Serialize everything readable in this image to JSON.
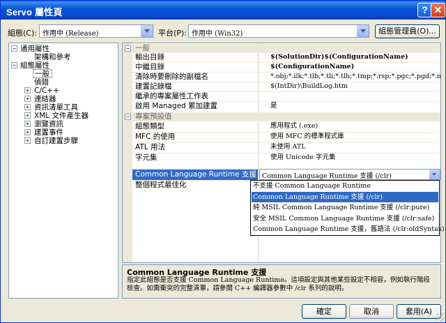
{
  "window": {
    "title": "Servo 屬性頁",
    "help_label": "?",
    "close_label": "✕"
  },
  "config_bar": {
    "config_label": "組態(C):",
    "config_value": "作用中 (Release)",
    "platform_label": "平台(P):",
    "platform_value": "作用中 (Win32)",
    "manager_button": "組態管理員(O)..."
  },
  "tree": {
    "items": [
      {
        "label": "通用屬性",
        "expand": "−"
      },
      {
        "label": "架構和參考",
        "expand": ""
      },
      {
        "label": "組態屬性",
        "expand": "−"
      },
      {
        "label": "一般",
        "expand": ""
      },
      {
        "label": "偵錯",
        "expand": ""
      },
      {
        "label": "C/C++",
        "expand": "+"
      },
      {
        "label": "連結器",
        "expand": "+"
      },
      {
        "label": "資訊清單工具",
        "expand": "+"
      },
      {
        "label": "XML 文件產生器",
        "expand": "+"
      },
      {
        "label": "瀏覽資訊",
        "expand": "+"
      },
      {
        "label": "建置事件",
        "expand": "+"
      },
      {
        "label": "自訂建置步驟",
        "expand": "+"
      }
    ]
  },
  "grid": {
    "categories": [
      {
        "label": "一般",
        "toggle": "−"
      },
      {
        "label": "專案預設值",
        "toggle": "−"
      }
    ],
    "general_rows": [
      {
        "name": "輸出目錄",
        "value": "$(SolutionDir)$(ConfigurationName)"
      },
      {
        "name": "中繼目錄",
        "value": "$(ConfigurationName)"
      },
      {
        "name": "清除時要刪除的副檔名",
        "value": "*.obj;*.ilk;*.tlb;*.tli;*.tlh;*.tmp;*.rsp;*.pgc;*.pgd;*.meta;$(Targ"
      },
      {
        "name": "建置記錄檔",
        "value": "$(IntDir)\\BuildLog.htm"
      },
      {
        "name": "繼承的專案屬性工作表",
        "value": ""
      },
      {
        "name": "啟用 Managed 累加建置",
        "value": "是"
      }
    ],
    "default_rows": [
      {
        "name": "組態類型",
        "value": "應用程式 (.exe)"
      },
      {
        "name": "MFC 的使用",
        "value": "使用 MFC 的標準程式庫"
      },
      {
        "name": "ATL 用法",
        "value": "未使用 ATL"
      },
      {
        "name": "字元集",
        "value": "使用 Unicode 字元集"
      },
      {
        "name": "Common Language Runtime 支援",
        "value": "Common Language Runtime 支援 (/clr)"
      },
      {
        "name": "整個程式最佳化",
        "value": ""
      }
    ],
    "dropdown_options": [
      "不支援 Common Language Runtime",
      "Common Language Runtime 支援 (/clr)",
      "純 MSIL Common Language Runtime 支援 (/clr:pure)",
      "安全 MSIL Common Language Runtime 支援 (/clr:safe)",
      "Common Language Runtime 支援，舊語法 (/clr:oldSyntax)"
    ],
    "dropdown_selected_index": 1
  },
  "description": {
    "title": "Common Language Runtime 支援",
    "text": "指定此組態是否支援 Common Language Runtime。這項設定與其他某些設定不相容，例如執行階段檢查。如需衝突的完整清單，請參閱 C++ 編譯器參數中 /clr 系列的說明。"
  },
  "buttons": {
    "ok": "確定",
    "cancel": "取消",
    "apply": "套用(A)"
  }
}
